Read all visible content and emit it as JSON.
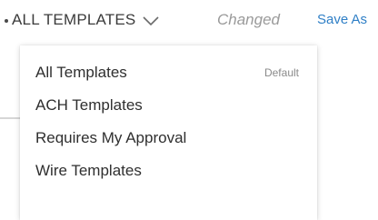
{
  "toolbar": {
    "view_label": "ALL TEMPLATES",
    "status": "Changed",
    "save_as_label": "Save As"
  },
  "menu": {
    "items": [
      {
        "label": "All Templates",
        "tag": "Default"
      },
      {
        "label": "ACH Templates"
      },
      {
        "label": "Requires My Approval"
      },
      {
        "label": "Wire Templates"
      }
    ]
  },
  "icons": {
    "modified_indicator": "dot-icon",
    "dropdown": "chevron-down-icon"
  },
  "colors": {
    "text": "#3b3b3b",
    "muted": "#9a9a9a",
    "link": "#2f7fc6"
  }
}
